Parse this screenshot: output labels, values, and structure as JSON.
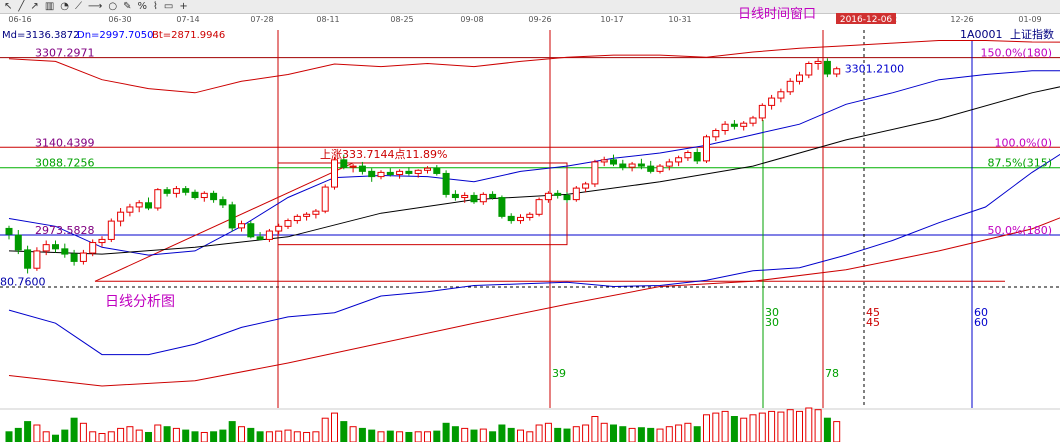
{
  "toolbar_icons": [
    "cursor-icon",
    "line-icon",
    "arrow-icon",
    "bar-icon",
    "fan-icon",
    "trend-icon",
    "ray-icon",
    "circle-icon",
    "note-icon",
    "percent-icon",
    "polyline-icon",
    "label-icon",
    "plus-icon"
  ],
  "dates": [
    "06-16",
    "06-30",
    "07-14",
    "07-28",
    "08-11",
    "08-25",
    "09-08",
    "09-26",
    "10-17",
    "10-31",
    "12",
    "12-26",
    "01-09"
  ],
  "cursor_date": "2016-12-06",
  "window_label": "日线时间窗口",
  "analysis_label": "日线分析图",
  "index_code": "1A0001",
  "index_name": "上证指数",
  "bollinger": {
    "md_label": "Md=3136.3872",
    "dn_label": "Dn=2997.7050",
    "bt_label": "Bt=2871.9946"
  },
  "rise_annotation": "上涨333.7144点11.89%",
  "price_labels": [
    "3307.2971",
    "3140.4399",
    "3088.7256",
    "2973.5828",
    "80.7600",
    "3301.2100"
  ],
  "fib_labels": [
    "150.0%(180)",
    "100.0%(0)",
    "87.5%(315)",
    "50.0%(180)"
  ],
  "cycle_labels": [
    "30",
    "30",
    "45",
    "45",
    "60",
    "60",
    "39",
    "78"
  ],
  "colors": {
    "up": "#e60000",
    "down": "#009a00",
    "ma_black": "#000000",
    "boll_mid": "#0000cc",
    "boll_outer": "#cc0000",
    "accent": "#c000c0",
    "toolbar_bg": "#ececec"
  },
  "chart_data": {
    "type": "candlestick",
    "ylim": [
      2638,
      3360
    ],
    "highlight_x": 63,
    "candles": [
      [
        2981,
        2986,
        2960,
        2970
      ],
      [
        2968,
        2978,
        2932,
        2940
      ],
      [
        2940,
        2948,
        2895,
        2905
      ],
      [
        2905,
        2945,
        2900,
        2938
      ],
      [
        2938,
        2958,
        2930,
        2950
      ],
      [
        2950,
        2958,
        2935,
        2942
      ],
      [
        2942,
        2952,
        2925,
        2932
      ],
      [
        2932,
        2940,
        2910,
        2918
      ],
      [
        2918,
        2940,
        2912,
        2934
      ],
      [
        2934,
        2960,
        2928,
        2954
      ],
      [
        2954,
        2966,
        2946,
        2960
      ],
      [
        2960,
        3000,
        2955,
        2995
      ],
      [
        2995,
        3020,
        2985,
        3012
      ],
      [
        3012,
        3028,
        3004,
        3022
      ],
      [
        3022,
        3035,
        3012,
        3030
      ],
      [
        3030,
        3040,
        3016,
        3020
      ],
      [
        3020,
        3058,
        3015,
        3055
      ],
      [
        3055,
        3060,
        3042,
        3048
      ],
      [
        3048,
        3062,
        3040,
        3057
      ],
      [
        3057,
        3062,
        3044,
        3050
      ],
      [
        3050,
        3055,
        3036,
        3040
      ],
      [
        3040,
        3052,
        3032,
        3048
      ],
      [
        3048,
        3053,
        3030,
        3036
      ],
      [
        3036,
        3042,
        3020,
        3026
      ],
      [
        3026,
        3032,
        2975,
        2982
      ],
      [
        2982,
        2996,
        2975,
        2990
      ],
      [
        2990,
        2995,
        2962,
        2965
      ],
      [
        2965,
        2974,
        2958,
        2960
      ],
      [
        2960,
        2980,
        2955,
        2976
      ],
      [
        2976,
        2990,
        2970,
        2985
      ],
      [
        2985,
        3000,
        2980,
        2996
      ],
      [
        2996,
        3008,
        2990,
        3004
      ],
      [
        3004,
        3012,
        2996,
        3008
      ],
      [
        3008,
        3018,
        3000,
        3014
      ],
      [
        3014,
        3065,
        3010,
        3060
      ],
      [
        3060,
        3118,
        3055,
        3112
      ],
      [
        3112,
        3122,
        3094,
        3098
      ],
      [
        3098,
        3104,
        3088,
        3100
      ],
      [
        3100,
        3108,
        3084,
        3090
      ],
      [
        3090,
        3096,
        3070,
        3080
      ],
      [
        3080,
        3092,
        3075,
        3088
      ],
      [
        3088,
        3096,
        3080,
        3084
      ],
      [
        3084,
        3094,
        3076,
        3090
      ],
      [
        3090,
        3098,
        3082,
        3086
      ],
      [
        3086,
        3094,
        3078,
        3092
      ],
      [
        3092,
        3100,
        3086,
        3096
      ],
      [
        3096,
        3102,
        3082,
        3086
      ],
      [
        3086,
        3092,
        3040,
        3046
      ],
      [
        3046,
        3054,
        3034,
        3040
      ],
      [
        3040,
        3050,
        3030,
        3044
      ],
      [
        3044,
        3050,
        3028,
        3032
      ],
      [
        3032,
        3050,
        3026,
        3046
      ],
      [
        3046,
        3052,
        3036,
        3040
      ],
      [
        3040,
        3044,
        3000,
        3004
      ],
      [
        3004,
        3010,
        2990,
        2996
      ],
      [
        2996,
        3008,
        2990,
        3002
      ],
      [
        3002,
        3012,
        2996,
        3008
      ],
      [
        3008,
        3040,
        3004,
        3036
      ],
      [
        3036,
        3052,
        3030,
        3048
      ],
      [
        3048,
        3054,
        3038,
        3044
      ],
      [
        3044,
        3050,
        3030,
        3036
      ],
      [
        3036,
        3062,
        3032,
        3058
      ],
      [
        3058,
        3070,
        3050,
        3066
      ],
      [
        3066,
        3112,
        3060,
        3108
      ],
      [
        3108,
        3118,
        3100,
        3112
      ],
      [
        3112,
        3122,
        3100,
        3104
      ],
      [
        3104,
        3112,
        3092,
        3098
      ],
      [
        3098,
        3108,
        3090,
        3104
      ],
      [
        3104,
        3114,
        3094,
        3100
      ],
      [
        3100,
        3110,
        3086,
        3090
      ],
      [
        3090,
        3104,
        3086,
        3100
      ],
      [
        3100,
        3114,
        3092,
        3108
      ],
      [
        3108,
        3120,
        3100,
        3116
      ],
      [
        3116,
        3130,
        3110,
        3126
      ],
      [
        3126,
        3134,
        3104,
        3110
      ],
      [
        3110,
        3160,
        3106,
        3156
      ],
      [
        3156,
        3172,
        3148,
        3168
      ],
      [
        3168,
        3186,
        3160,
        3180
      ],
      [
        3180,
        3188,
        3170,
        3176
      ],
      [
        3176,
        3186,
        3168,
        3182
      ],
      [
        3182,
        3196,
        3176,
        3192
      ],
      [
        3192,
        3220,
        3186,
        3216
      ],
      [
        3216,
        3236,
        3208,
        3230
      ],
      [
        3230,
        3248,
        3222,
        3242
      ],
      [
        3242,
        3268,
        3236,
        3262
      ],
      [
        3262,
        3280,
        3256,
        3274
      ],
      [
        3274,
        3300,
        3268,
        3296
      ],
      [
        3296,
        3306,
        3284,
        3300
      ],
      [
        3300,
        3306,
        3270,
        3276
      ],
      [
        3276,
        3290,
        3270,
        3286
      ]
    ],
    "volume_bars": [
      0.3,
      0.4,
      0.6,
      0.5,
      0.3,
      0.2,
      0.35,
      0.7,
      0.55,
      0.3,
      0.25,
      0.3,
      0.4,
      0.45,
      0.35,
      0.28,
      0.5,
      0.45,
      0.4,
      0.35,
      0.3,
      0.28,
      0.3,
      0.35,
      0.6,
      0.45,
      0.4,
      0.3,
      0.3,
      0.32,
      0.35,
      0.3,
      0.28,
      0.3,
      0.7,
      0.85,
      0.6,
      0.45,
      0.4,
      0.35,
      0.3,
      0.32,
      0.3,
      0.28,
      0.3,
      0.3,
      0.32,
      0.55,
      0.45,
      0.4,
      0.35,
      0.38,
      0.3,
      0.5,
      0.4,
      0.35,
      0.3,
      0.5,
      0.55,
      0.4,
      0.38,
      0.45,
      0.5,
      0.75,
      0.55,
      0.5,
      0.45,
      0.4,
      0.42,
      0.4,
      0.38,
      0.45,
      0.5,
      0.55,
      0.45,
      0.8,
      0.85,
      0.9,
      0.75,
      0.7,
      0.8,
      0.85,
      0.9,
      0.88,
      0.95,
      0.9,
      1.0,
      0.95,
      0.7,
      0.6
    ],
    "ma_line": [
      [
        0,
        2938
      ],
      [
        10,
        2932
      ],
      [
        20,
        2945
      ],
      [
        30,
        2965
      ],
      [
        40,
        3010
      ],
      [
        50,
        3036
      ],
      [
        60,
        3046
      ],
      [
        70,
        3070
      ],
      [
        80,
        3100
      ],
      [
        90,
        3150
      ],
      [
        100,
        3190
      ],
      [
        110,
        3240
      ],
      [
        120,
        3278
      ],
      [
        125,
        3290
      ]
    ],
    "boll_upper": [
      [
        0,
        3305
      ],
      [
        5,
        3300
      ],
      [
        10,
        3265
      ],
      [
        15,
        3248
      ],
      [
        20,
        3240
      ],
      [
        25,
        3262
      ],
      [
        30,
        3275
      ],
      [
        35,
        3295
      ],
      [
        40,
        3290
      ],
      [
        45,
        3296
      ],
      [
        50,
        3290
      ],
      [
        55,
        3300
      ],
      [
        60,
        3308
      ],
      [
        65,
        3312
      ],
      [
        70,
        3312
      ],
      [
        75,
        3308
      ],
      [
        80,
        3318
      ],
      [
        85,
        3325
      ],
      [
        90,
        3330
      ],
      [
        95,
        3335
      ],
      [
        100,
        3340
      ],
      [
        105,
        3340
      ],
      [
        110,
        3337
      ],
      [
        120,
        3336
      ],
      [
        125,
        3338
      ]
    ],
    "boll_mid": [
      [
        0,
        3000
      ],
      [
        5,
        2985
      ],
      [
        10,
        2945
      ],
      [
        15,
        2930
      ],
      [
        20,
        2938
      ],
      [
        25,
        2985
      ],
      [
        30,
        3040
      ],
      [
        35,
        3078
      ],
      [
        40,
        3082
      ],
      [
        45,
        3080
      ],
      [
        50,
        3070
      ],
      [
        55,
        3090
      ],
      [
        60,
        3100
      ],
      [
        65,
        3115
      ],
      [
        70,
        3125
      ],
      [
        75,
        3140
      ],
      [
        80,
        3160
      ],
      [
        85,
        3180
      ],
      [
        90,
        3218
      ],
      [
        95,
        3240
      ],
      [
        100,
        3265
      ],
      [
        105,
        3275
      ],
      [
        110,
        3282
      ],
      [
        115,
        3282
      ],
      [
        125,
        3302
      ]
    ],
    "boll_lower": [
      [
        0,
        2825
      ],
      [
        5,
        2800
      ],
      [
        10,
        2740
      ],
      [
        15,
        2740
      ],
      [
        20,
        2760
      ],
      [
        25,
        2792
      ],
      [
        30,
        2812
      ],
      [
        35,
        2820
      ],
      [
        40,
        2852
      ],
      [
        45,
        2860
      ],
      [
        50,
        2872
      ],
      [
        55,
        2875
      ],
      [
        60,
        2878
      ],
      [
        65,
        2870
      ],
      [
        70,
        2872
      ],
      [
        75,
        2882
      ],
      [
        80,
        2900
      ],
      [
        85,
        2906
      ],
      [
        90,
        2930
      ],
      [
        95,
        2958
      ],
      [
        100,
        2992
      ],
      [
        105,
        3022
      ],
      [
        110,
        3088
      ],
      [
        115,
        3145
      ],
      [
        120,
        3180
      ],
      [
        125,
        3200
      ]
    ],
    "boll_lowest": [
      [
        0,
        2700
      ],
      [
        10,
        2680
      ],
      [
        20,
        2690
      ],
      [
        30,
        2724
      ],
      [
        40,
        2762
      ],
      [
        50,
        2800
      ],
      [
        60,
        2836
      ],
      [
        70,
        2870
      ],
      [
        80,
        2880
      ],
      [
        90,
        2902
      ],
      [
        100,
        2938
      ],
      [
        110,
        2980
      ],
      [
        120,
        3050
      ],
      [
        125,
        3120
      ]
    ]
  }
}
